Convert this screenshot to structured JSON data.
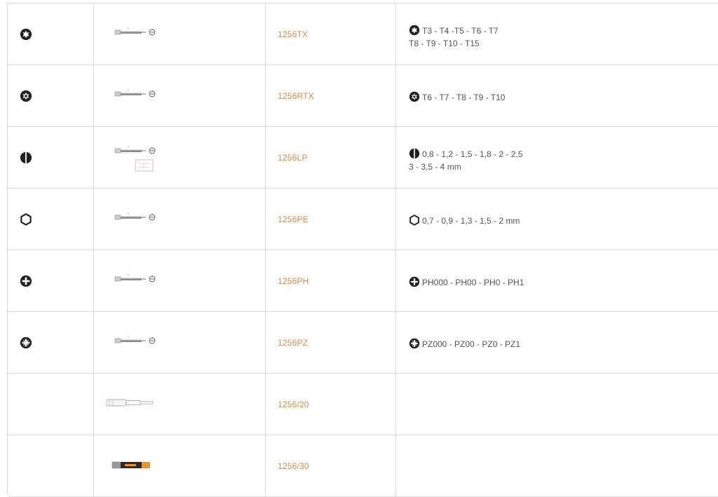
{
  "rows": [
    {
      "code": "1256TX",
      "icon": "torx-icon",
      "sizes_line1": "T3 - T4 -T5 - T6 - T7",
      "sizes_line2": "T8 - T9 - T10 - T15"
    },
    {
      "code": "1256RTX",
      "icon": "torx-tamper-icon",
      "sizes_line1": "T6 - T7 - T8 - T9 - T10",
      "sizes_line2": ""
    },
    {
      "code": "1256LP",
      "icon": "slotted-icon",
      "sizes_line1": "0,8 - 1,2 - 1,5 - 1,8 - 2 - 2,5",
      "sizes_line2": "3 - 3,5 - 4 mm"
    },
    {
      "code": "1256PE",
      "icon": "hexagon-icon",
      "sizes_line1": "0,7 - 0,9 - 1,3 - 1,5 - 2 mm",
      "sizes_line2": ""
    },
    {
      "code": "1256PH",
      "icon": "phillips-icon",
      "sizes_line1": "PH000 - PH00 - PH0 - PH1",
      "sizes_line2": ""
    },
    {
      "code": "1256PZ",
      "icon": "pozidriv-icon",
      "sizes_line1": "PZ000 - PZ00 - PZ0 - PZ1",
      "sizes_line2": ""
    },
    {
      "code": "1256/20",
      "icon": "",
      "sizes_line1": "",
      "sizes_line2": ""
    },
    {
      "code": "1256/30",
      "icon": "",
      "sizes_line1": "",
      "sizes_line2": ""
    }
  ],
  "colors": {
    "code": "#d58a45",
    "border": "#dcdcdc",
    "icon": "#222222"
  }
}
